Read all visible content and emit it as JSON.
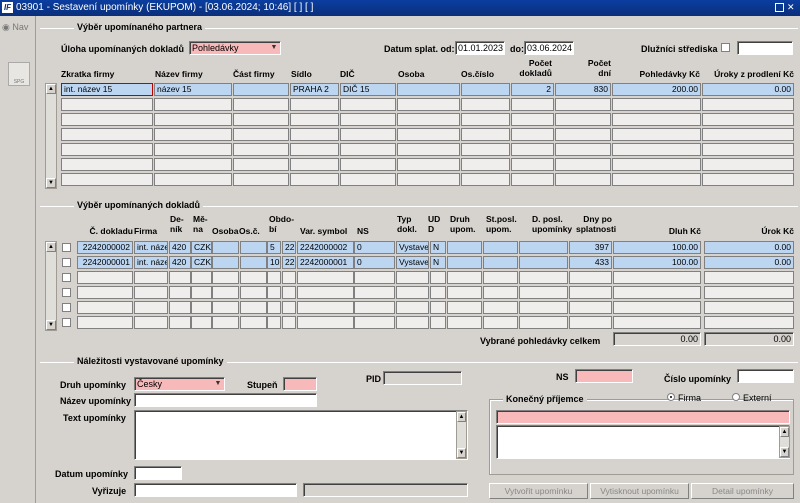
{
  "window": {
    "title": "03901 - Sestavení upomínky (EKUPOM) - [03.06.2024; 10:46] [ ] [ ]"
  },
  "sidebar": {
    "nav_label": "Nav",
    "spg_label": "SPG"
  },
  "partner_section": {
    "title": "Výběr upomínaného partnera",
    "task_label": "Úloha upomínaných dokladů",
    "task_value": "Pohledávky",
    "due_from_label": "Datum splat. od:",
    "due_from_value": "01.01.2023",
    "due_to_label": "do:",
    "due_to_value": "03.06.2024",
    "centers_label": "Dlužníci střediska",
    "centers_value": "",
    "columns": [
      "Zkratka firmy",
      "Název firmy",
      "Část firmy",
      "Sídlo",
      "DIČ",
      "Osoba",
      "Os.číslo",
      "Počet dokladů",
      "Počet dní",
      "Pohledávky Kč",
      "Úroky z prodlení Kč"
    ],
    "rows": [
      [
        "int. název 15",
        "název 15",
        "",
        "PRAHA 2",
        "DIČ 15",
        "",
        "",
        "2",
        "830",
        "200.00",
        "0.00"
      ]
    ]
  },
  "docs_section": {
    "title": "Výběr upomínaných dokladů",
    "columns": [
      "Č. dokladu",
      "Firma",
      "De-ník",
      "Mě-na",
      "Osoba",
      "Os.č.",
      "Obdo-bí",
      "Var. symbol",
      "NS",
      "Typ dokl.",
      "UD D",
      "Druh upom.",
      "St.posl. upom.",
      "D. posl. upomínky",
      "Dny po splatnosti",
      "Dluh Kč",
      "Úrok Kč"
    ],
    "col_headers": {
      "doc": "Č. dokladu",
      "firm": "Firma",
      "journal": "De-\nník",
      "currency": "Mě-\nna",
      "person": "Osoba",
      "person_no": "Os.č.",
      "period": "Obdo-\nbí",
      "varsym": "Var. symbol",
      "ns": "NS",
      "type": "Typ\ndokl.",
      "ud": "UD\nD",
      "kind": "Druh\nupom.",
      "last_state": "St.posl.\nupom.",
      "last_date": "D. posl.\nupomínky",
      "days": "Dny po\nsplatnosti",
      "debt": "Dluh Kč",
      "interest": "Úrok Kč"
    },
    "rows": [
      {
        "doc": "2242000002",
        "firm": "int. náze",
        "journal": "420",
        "currency": "CZK",
        "person": "",
        "person_no": "",
        "period_a": "5",
        "period_b": "22",
        "varsym": "2242000002",
        "ns": "0",
        "type": "Vystave",
        "ud": "N",
        "kind": "",
        "last_state": "",
        "last_date": "",
        "days": "397",
        "debt": "100.00",
        "interest": "0.00"
      },
      {
        "doc": "2242000001",
        "firm": "int. náze",
        "journal": "420",
        "currency": "CZK",
        "person": "",
        "person_no": "",
        "period_a": "10",
        "period_b": "22",
        "varsym": "2242000001",
        "ns": "0",
        "type": "Vystave",
        "ud": "N",
        "kind": "",
        "last_state": "",
        "last_date": "",
        "days": "433",
        "debt": "100.00",
        "interest": "0.00"
      }
    ],
    "total_label": "Vybrané pohledávky celkem",
    "total_debt": "0.00",
    "total_interest": "0.00"
  },
  "details_section": {
    "title": "Náležitosti vystavované upomínky",
    "kind_label": "Druh upomínky",
    "kind_value": "Česky",
    "level_label": "Stupeň",
    "level_value": "",
    "pid_label": "PID",
    "pid_value": "",
    "ns_label": "NS",
    "ns_value": "",
    "number_label": "Číslo upomínky",
    "number_value": "",
    "name_label": "Název upomínky",
    "name_value": "",
    "text_label": "Text upomínky",
    "text_value": "",
    "recipient_label": "Konečný příjemce",
    "radio_firm": "Firma",
    "radio_external": "Externí",
    "date_label": "Datum upomínky",
    "date_value": "",
    "handler_label": "Vyřizuje",
    "handler_value": "",
    "btn_create": "Vytvořit upomínku",
    "btn_print": "Vytisknout upomínku",
    "btn_detail": "Detail upomínky"
  }
}
